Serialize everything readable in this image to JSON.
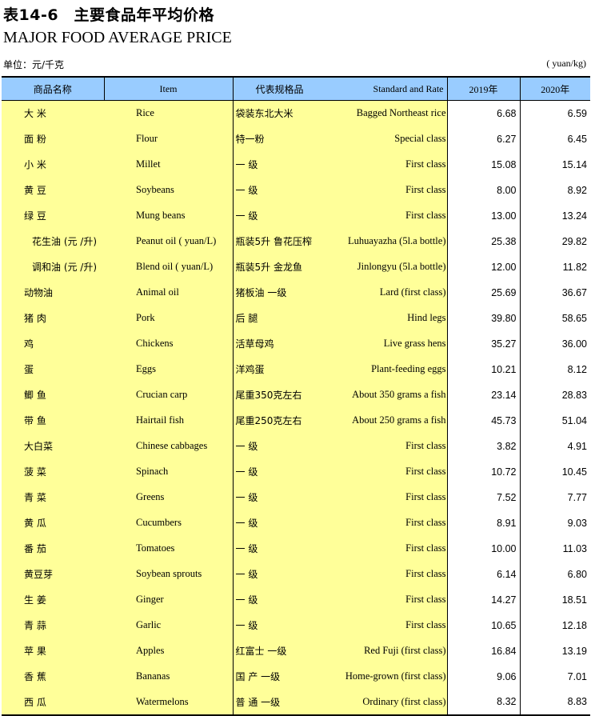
{
  "header": {
    "title_cn": "表14-6　主要食品年平均价格",
    "title_en": "MAJOR FOOD AVERAGE PRICE",
    "unit_cn": "单位：元/千克",
    "unit_en": "( yuan/kg)"
  },
  "table": {
    "columns": {
      "name_cn": "商品名称",
      "item_en": "Item",
      "std_cn": "代表规格品",
      "std_en": "Standard and Rate",
      "y2019": "2019年",
      "y2020": "2020年"
    },
    "rows": [
      {
        "cn": "大 米",
        "en": "Rice",
        "std_cn": "袋装东北大米",
        "std_en": "Bagged Northeast rice",
        "v2019": "6.68",
        "v2020": "6.59"
      },
      {
        "cn": "面 粉",
        "en": "Flour",
        "std_cn": "特一粉",
        "std_en": "Special class",
        "v2019": "6.27",
        "v2020": "6.45"
      },
      {
        "cn": "小 米",
        "en": "Millet",
        "std_cn": "一 级",
        "std_en": "First class",
        "v2019": "15.08",
        "v2020": "15.14"
      },
      {
        "cn": "黄 豆",
        "en": "Soybeans",
        "std_cn": "一 级",
        "std_en": "First class",
        "v2019": "8.00",
        "v2020": "8.92"
      },
      {
        "cn": "绿 豆",
        "en": "Mung beans",
        "std_cn": "一 级",
        "std_en": "First class",
        "v2019": "13.00",
        "v2020": "13.24"
      },
      {
        "cn": "花生油 (元 /升)",
        "en": "Peanut oil ( yuan/L)",
        "std_cn": "瓶装5升 鲁花压榨",
        "std_en": "Luhuayazha (5l.a bottle)",
        "v2019": "25.38",
        "v2020": "29.82",
        "indent": true
      },
      {
        "cn": "调和油 (元 /升)",
        "en": "Blend oil ( yuan/L)",
        "std_cn": "瓶装5升 金龙鱼",
        "std_en": "Jinlongyu (5l.a bottle)",
        "v2019": "12.00",
        "v2020": "11.82",
        "indent": true
      },
      {
        "cn": "动物油",
        "en": "Animal oil",
        "std_cn": "猪板油 一级",
        "std_en": "Lard  (first class)",
        "v2019": "25.69",
        "v2020": "36.67"
      },
      {
        "cn": "猪 肉",
        "en": "Pork",
        "std_cn": "后 腿",
        "std_en": "Hind legs",
        "v2019": "39.80",
        "v2020": "58.65"
      },
      {
        "cn": "鸡",
        "en": "Chickens",
        "std_cn": "活草母鸡",
        "std_en": "Live grass hens",
        "v2019": "35.27",
        "v2020": "36.00"
      },
      {
        "cn": "蛋",
        "en": "Eggs",
        "std_cn": "洋鸡蛋",
        "std_en": "Plant-feeding eggs",
        "v2019": "10.21",
        "v2020": "8.12"
      },
      {
        "cn": "鲫 鱼",
        "en": "Crucian carp",
        "std_cn": "尾重350克左右",
        "std_en": "About 350 grams a fish",
        "v2019": "23.14",
        "v2020": "28.83"
      },
      {
        "cn": "带 鱼",
        "en": "Hairtail fish",
        "std_cn": "尾重250克左右",
        "std_en": "About 250 grams a fish",
        "v2019": "45.73",
        "v2020": "51.04"
      },
      {
        "cn": "大白菜",
        "en": "Chinese cabbages",
        "std_cn": "一 级",
        "std_en": "First class",
        "v2019": "3.82",
        "v2020": "4.91"
      },
      {
        "cn": "菠 菜",
        "en": "Spinach",
        "std_cn": "一 级",
        "std_en": "First class",
        "v2019": "10.72",
        "v2020": "10.45"
      },
      {
        "cn": "青 菜",
        "en": "Greens",
        "std_cn": "一 级",
        "std_en": "First class",
        "v2019": "7.52",
        "v2020": "7.77"
      },
      {
        "cn": "黄 瓜",
        "en": "Cucumbers",
        "std_cn": "一 级",
        "std_en": "First class",
        "v2019": "8.91",
        "v2020": "9.03"
      },
      {
        "cn": "番 茄",
        "en": "Tomatoes",
        "std_cn": "一 级",
        "std_en": "First class",
        "v2019": "10.00",
        "v2020": "11.03"
      },
      {
        "cn": "黄豆芽",
        "en": "Soybean sprouts",
        "std_cn": "一 级",
        "std_en": "First class",
        "v2019": "6.14",
        "v2020": "6.80"
      },
      {
        "cn": "生 姜",
        "en": "Ginger",
        "std_cn": "一 级",
        "std_en": "First class",
        "v2019": "14.27",
        "v2020": "18.51"
      },
      {
        "cn": "青 蒜",
        "en": "Garlic",
        "std_cn": "一 级",
        "std_en": "First class",
        "v2019": "10.65",
        "v2020": "12.18"
      },
      {
        "cn": "苹 果",
        "en": "Apples",
        "std_cn": "红富士 一级",
        "std_en": "Red Fuji (first class)",
        "v2019": "16.84",
        "v2020": "13.19"
      },
      {
        "cn": "香 蕉",
        "en": "Bananas",
        "std_cn": "国 产 一级",
        "std_en": "Home-grown (first class)",
        "v2019": "9.06",
        "v2020": "7.01"
      },
      {
        "cn": "西 瓜",
        "en": "Watermelons",
        "std_cn": "普 通 一级",
        "std_en": "Ordinary (first class)",
        "v2019": "8.32",
        "v2020": "8.83"
      }
    ]
  },
  "colors": {
    "header_bg": "#99ccff",
    "highlight_bg": "#ffff99"
  }
}
